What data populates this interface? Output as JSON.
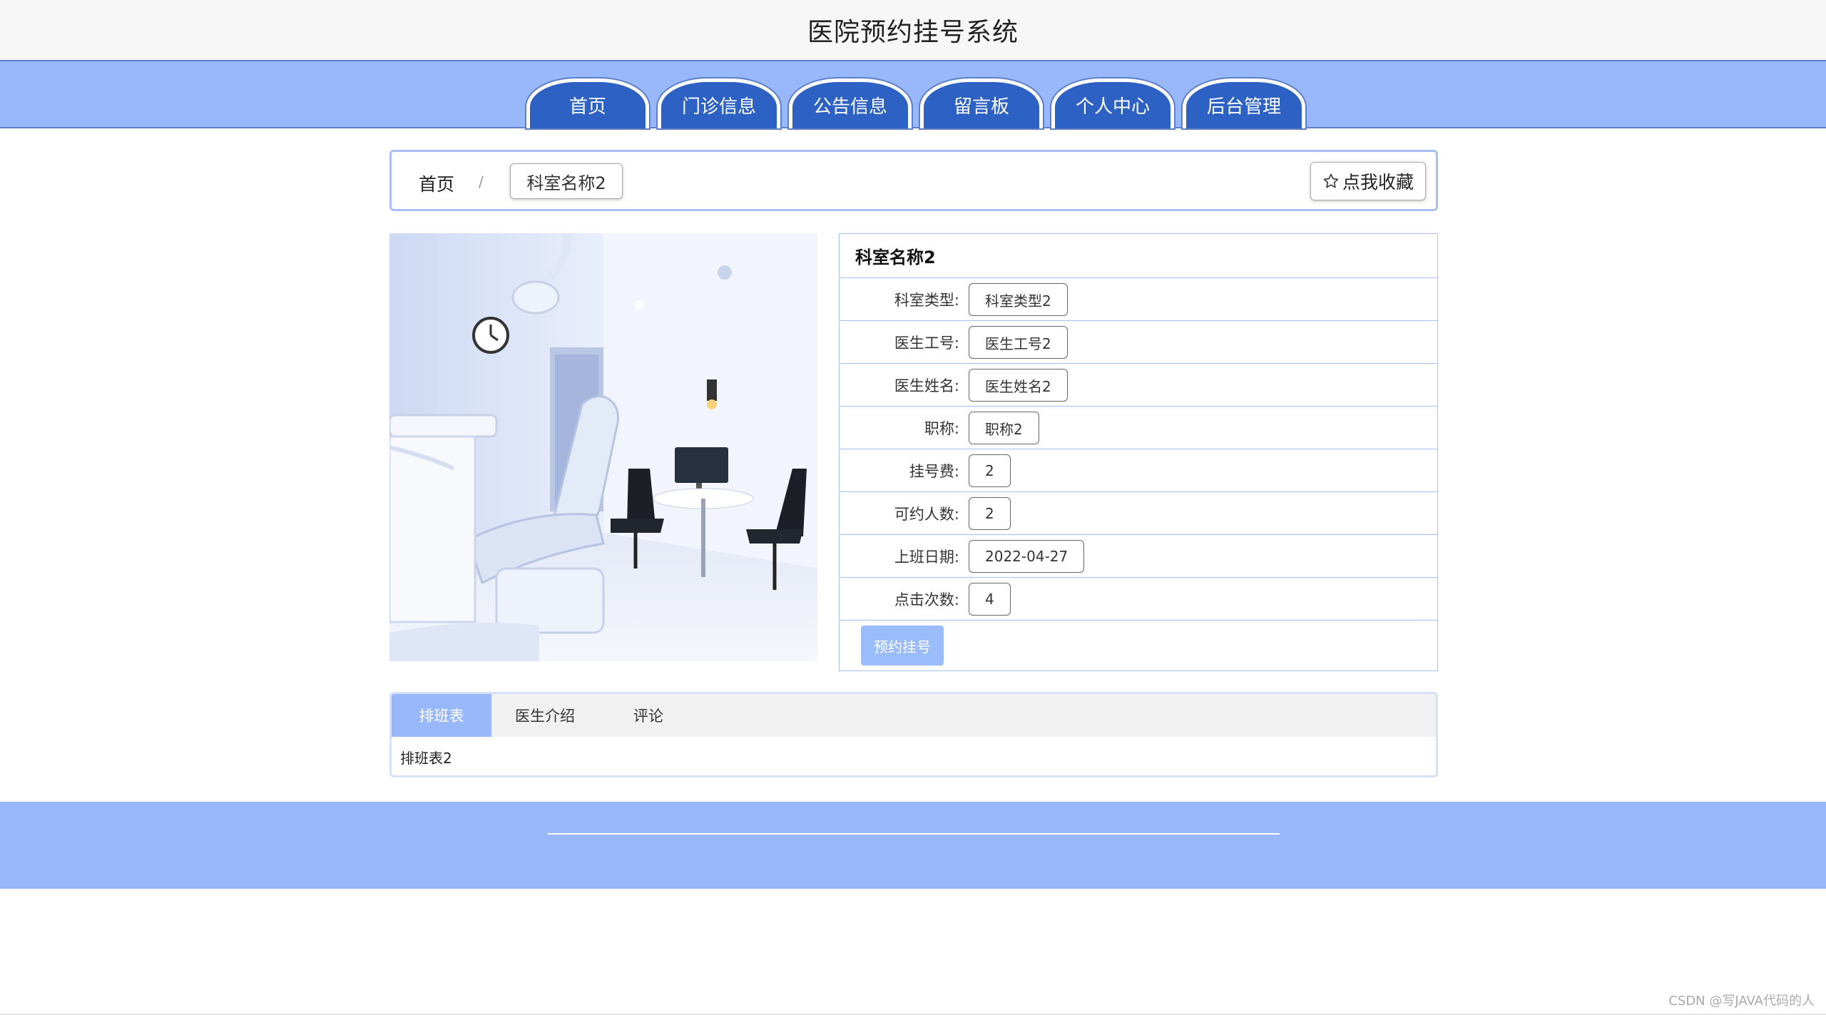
{
  "site": {
    "title": "医院预约挂号系统"
  },
  "nav": {
    "items": [
      {
        "label": "首页"
      },
      {
        "label": "门诊信息"
      },
      {
        "label": "公告信息"
      },
      {
        "label": "留言板"
      },
      {
        "label": "个人中心"
      },
      {
        "label": "后台管理"
      }
    ]
  },
  "breadcrumb": {
    "home": "首页",
    "separator": "/",
    "current": "科室名称2"
  },
  "favorite": {
    "label": "点我收藏",
    "icon": "star-outline-icon"
  },
  "detail": {
    "title": "科室名称2",
    "rows": [
      {
        "label": "科室类型:",
        "value": "科室类型2"
      },
      {
        "label": "医生工号:",
        "value": "医生工号2"
      },
      {
        "label": "医生姓名:",
        "value": "医生姓名2"
      },
      {
        "label": "职称:",
        "value": "职称2"
      },
      {
        "label": "挂号费:",
        "value": "2"
      },
      {
        "label": "可约人数:",
        "value": "2"
      },
      {
        "label": "上班日期:",
        "value": "2022-04-27"
      },
      {
        "label": "点击次数:",
        "value": "4"
      }
    ],
    "book_label": "预约挂号"
  },
  "tabs": {
    "items": [
      {
        "label": "排班表",
        "active": true
      },
      {
        "label": "医生介绍",
        "active": false
      },
      {
        "label": "评论",
        "active": false
      }
    ],
    "content": "排班表2"
  },
  "watermark": "CSDN @写JAVA代码的人",
  "colors": {
    "nav_bg": "#98b8fb",
    "nav_tab": "#2e61c4",
    "accent_border": "#a8c0f5",
    "book_button": "#9abcfb"
  }
}
